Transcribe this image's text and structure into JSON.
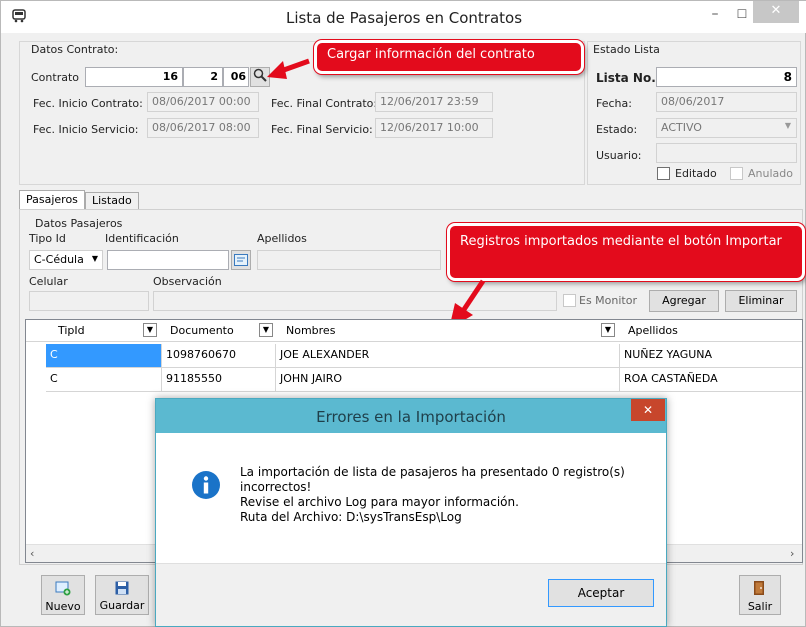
{
  "window": {
    "title": "Lista de Pasajeros en Contratos",
    "minimize": "–",
    "maximize": "☐",
    "close": "✕"
  },
  "contract": {
    "group_label": "Datos Contrato:",
    "contrato_label": "Contrato",
    "contrato_parts": [
      "16",
      "2",
      "06"
    ],
    "fec_inicio_contrato_label": "Fec. Inicio Contrato:",
    "fec_inicio_contrato": "08/06/2017 00:00",
    "fec_final_contrato_label": "Fec. Final Contrato:",
    "fec_final_contrato": "12/06/2017 23:59",
    "fec_inicio_servicio_label": "Fec. Inicio Servicio:",
    "fec_inicio_servicio": "08/06/2017 08:00",
    "fec_final_servicio_label": "Fec. Final Servicio:",
    "fec_final_servicio": "12/06/2017 10:00"
  },
  "estado": {
    "group_label": "Estado Lista",
    "lista_label": "Lista No.",
    "lista_value": "8",
    "fecha_label": "Fecha:",
    "fecha_value": "08/06/2017",
    "estado_label": "Estado:",
    "estado_value": "ACTIVO",
    "usuario_label": "Usuario:",
    "usuario_value": "",
    "editado_label": "Editado",
    "anulado_label": "Anulado"
  },
  "callouts": {
    "cargar": "Cargar información del contrato",
    "registros": "Registros importados mediante el botón Importar"
  },
  "tabs": [
    "Pasajeros",
    "Listado"
  ],
  "passenger_form": {
    "group_label": "Datos Pasajeros",
    "tipo_id_label": "Tipo Id",
    "tipo_id_value": "C-Cédula",
    "identificacion_label": "Identificación",
    "apellidos_label": "Apellidos",
    "celular_label": "Celular",
    "observacion_label": "Observación",
    "es_monitor_label": "Es Monitor",
    "agregar_label": "Agregar",
    "eliminar_label": "Eliminar"
  },
  "grid": {
    "columns": [
      "TipId",
      "Documento",
      "Nombres",
      "Apellidos"
    ],
    "rows": [
      [
        "C",
        "1098760670",
        "JOE ALEXANDER",
        "NUÑEZ YAGUNA"
      ],
      [
        "C",
        "91185550",
        "JOHN JAIRO",
        "ROA CASTAÑEDA"
      ]
    ]
  },
  "toolbar": {
    "nuevo_label": "Nuevo",
    "guardar_label": "Guardar",
    "salir_label": "Salir"
  },
  "dialog": {
    "title": "Errores en la Importación",
    "close": "✕",
    "line1": "La importación de lista de pasajeros ha presentado 0 registro(s)",
    "line2": "incorrectos!",
    "line3": "Revise el archivo Log para mayor información.",
    "line4": "Ruta del Archivo: D:\\sysTransEsp\\Log",
    "button": "Aceptar"
  },
  "colors": {
    "callout": "#e30b1c",
    "dialog_title": "#5bb9d0",
    "selection": "#3399ff"
  }
}
